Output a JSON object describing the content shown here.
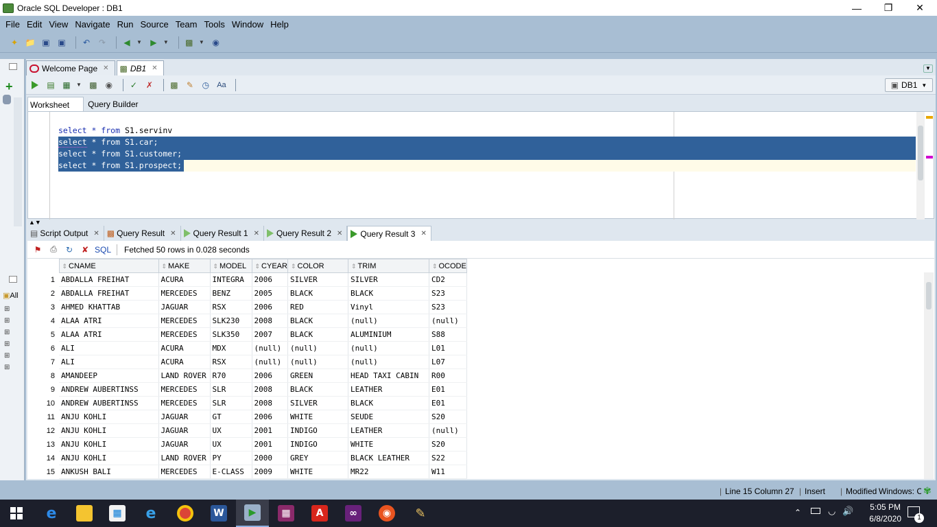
{
  "window": {
    "title": "Oracle SQL Developer : DB1"
  },
  "menu": [
    "File",
    "Edit",
    "View",
    "Navigate",
    "Run",
    "Source",
    "Team",
    "Tools",
    "Window",
    "Help"
  ],
  "doc_tabs": [
    {
      "label": "Welcome Page",
      "active": false
    },
    {
      "label": "DB1",
      "active": true
    }
  ],
  "connection": "DB1",
  "sub_tabs": [
    "Worksheet",
    "Query Builder"
  ],
  "sql_lines": [
    {
      "kw1": "select",
      "rest": " * from ",
      "obj": "S1.servinv",
      "selected": false
    },
    {
      "kw1": "select",
      "rest": " * from ",
      "obj": "S1.car;",
      "selected": true
    },
    {
      "kw1": "select",
      "rest": " * from ",
      "obj": "S1.customer;",
      "selected": true
    },
    {
      "kw1": "select",
      "rest": " * from ",
      "obj": "S1.prospect;",
      "selected": true
    }
  ],
  "result_tabs": [
    {
      "label": "Script Output",
      "active": false
    },
    {
      "label": "Query Result",
      "active": false
    },
    {
      "label": "Query Result 1",
      "active": false
    },
    {
      "label": "Query Result 2",
      "active": false
    },
    {
      "label": "Query Result 3",
      "active": true
    }
  ],
  "result_toolbar": {
    "sql_label": "SQL",
    "status": "Fetched 50 rows in 0.028 seconds"
  },
  "grid": {
    "columns": [
      "CNAME",
      "MAKE",
      "MODEL",
      "CYEAR",
      "COLOR",
      "TRIM",
      "OCODE"
    ],
    "rows": [
      [
        "1",
        "ABDALLA FREIHAT",
        "ACURA",
        "INTEGRA",
        "2006",
        "SILVER",
        "SILVER",
        "CD2"
      ],
      [
        "2",
        "ABDALLA FREIHAT",
        "MERCEDES",
        "BENZ",
        "2005",
        "BLACK",
        "BLACK",
        "S23"
      ],
      [
        "3",
        "AHMED KHATTAB",
        "JAGUAR",
        "RSX",
        "2006",
        "RED",
        "Vinyl",
        "S23"
      ],
      [
        "4",
        "ALAA ATRI",
        "MERCEDES",
        "SLK230",
        "2008",
        "BLACK",
        "(null)",
        "(null)"
      ],
      [
        "5",
        "ALAA ATRI",
        "MERCEDES",
        "SLK350",
        "2007",
        "BLACK",
        "ALUMINIUM",
        "S88"
      ],
      [
        "6",
        "ALI",
        "ACURA",
        "MDX",
        "(null)",
        "(null)",
        "(null)",
        "L01"
      ],
      [
        "7",
        "ALI",
        "ACURA",
        "RSX",
        "(null)",
        "(null)",
        "(null)",
        "L07"
      ],
      [
        "8",
        "AMANDEEP",
        "LAND ROVER",
        "R70",
        "2006",
        "GREEN",
        "HEAD TAXI CABIN",
        "R00"
      ],
      [
        "9",
        "ANDREW AUBERTINSS",
        "MERCEDES",
        "SLR",
        "2008",
        "BLACK",
        "LEATHER",
        "E01"
      ],
      [
        "10",
        "ANDREW AUBERTINSS",
        "MERCEDES",
        "SLR",
        "2008",
        "SILVER",
        "BLACK",
        "E01"
      ],
      [
        "11",
        "ANJU KOHLI",
        "JAGUAR",
        "GT",
        "2006",
        "WHITE",
        "SEUDE",
        "S20"
      ],
      [
        "12",
        "ANJU KOHLI",
        "JAGUAR",
        "UX",
        "2001",
        "INDIGO",
        "LEATHER",
        "(null)"
      ],
      [
        "13",
        "ANJU KOHLI",
        "JAGUAR",
        "UX",
        "2001",
        "INDIGO",
        "WHITE",
        "S20"
      ],
      [
        "14",
        "ANJU KOHLI",
        "LAND ROVER",
        "PY",
        "2000",
        "GREY",
        "BLACK LEATHER",
        "S22"
      ],
      [
        "15",
        "ANKUSH BALI",
        "MERCEDES",
        "E-CLASS",
        "2009",
        "WHITE",
        "MR22",
        "W11"
      ]
    ]
  },
  "status": {
    "position": "Line 15 Column 27",
    "mode": "Insert",
    "modified": "Modified",
    "eol": "Windows: CR"
  },
  "left_panel": {
    "all_label": "All"
  },
  "taskbar": {
    "time": "5:05 PM",
    "date": "6/8/2020",
    "notification_count": "1"
  }
}
